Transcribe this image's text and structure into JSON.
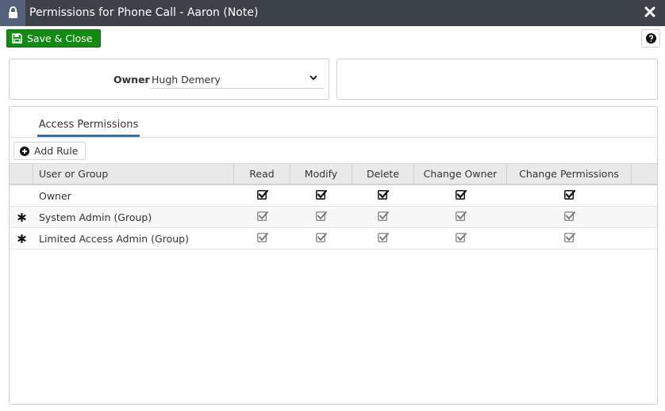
{
  "window": {
    "title": "Permissions for Phone Call - Aaron (Note)",
    "icons": {
      "lock": "lock-icon",
      "close": "close-icon"
    }
  },
  "toolbar": {
    "save_close_label": "Save & Close",
    "save_icon": "floppy-disk-icon",
    "help_icon": "question-circle-icon"
  },
  "owner": {
    "label": "Owner",
    "value": "Hugh Demery"
  },
  "tabs": [
    {
      "label": "Access Permissions",
      "active": true
    }
  ],
  "add_rule": {
    "label": "Add Rule",
    "icon": "plus-circle-icon"
  },
  "table": {
    "columns": [
      "User or Group",
      "Read",
      "Modify",
      "Delete",
      "Change Owner",
      "Change Permissions"
    ],
    "rows": [
      {
        "user": "Owner",
        "required": false,
        "editable": true,
        "read": true,
        "modify": true,
        "delete": true,
        "change_owner": true,
        "change_permissions": true
      },
      {
        "user": "System Admin (Group)",
        "required": true,
        "editable": false,
        "read": true,
        "modify": true,
        "delete": true,
        "change_owner": true,
        "change_permissions": true
      },
      {
        "user": "Limited Access Admin (Group)",
        "required": true,
        "editable": false,
        "read": true,
        "modify": true,
        "delete": true,
        "change_owner": true,
        "change_permissions": true
      }
    ]
  },
  "colors": {
    "titlebar": "#3d4148",
    "lock_tile": "#55607a",
    "save_button": "#138a13",
    "tab_underline": "#3a6ea5",
    "checkbox_disabled": "#777777",
    "checkbox_enabled": "#111111"
  }
}
